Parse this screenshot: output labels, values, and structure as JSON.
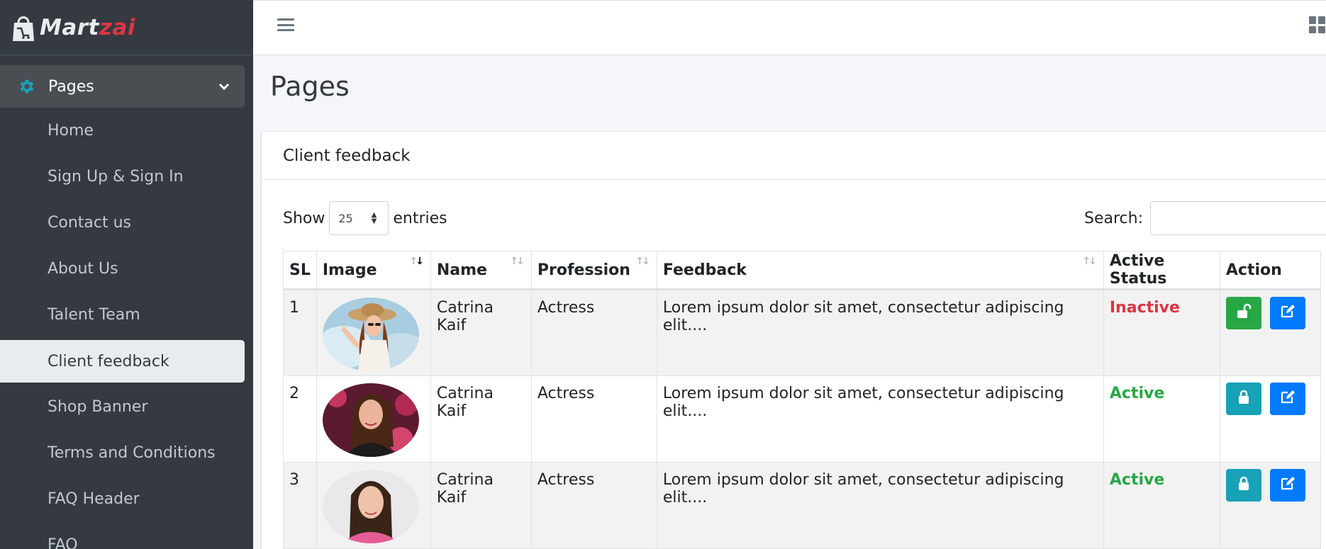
{
  "brand": {
    "name_part1": "Mart",
    "name_part2": "zai"
  },
  "sidebar": {
    "parent_label": "Pages",
    "items": [
      {
        "label": "Home",
        "active": false
      },
      {
        "label": "Sign Up & Sign In",
        "active": false
      },
      {
        "label": "Contact us",
        "active": false
      },
      {
        "label": "About Us",
        "active": false
      },
      {
        "label": "Talent Team",
        "active": false
      },
      {
        "label": "Client feedback",
        "active": true
      },
      {
        "label": "Shop Banner",
        "active": false
      },
      {
        "label": "Terms and Conditions",
        "active": false
      },
      {
        "label": "FAQ Header",
        "active": false
      },
      {
        "label": "FAQ",
        "active": false
      }
    ]
  },
  "page": {
    "title": "Pages"
  },
  "card": {
    "title": "Client feedback"
  },
  "table_controls": {
    "show_label": "Show",
    "entries_value": "25",
    "entries_label": "entries",
    "search_label": "Search:",
    "search_value": ""
  },
  "table": {
    "columns": [
      "SL",
      "Image",
      "Name",
      "Profession",
      "Feedback",
      "Active Status",
      "Action"
    ],
    "rows": [
      {
        "sl": "1",
        "name": "Catrina Kaif",
        "profession": "Actress",
        "feedback": "Lorem ipsum dolor sit amet, consectetur adipiscing elit....",
        "status": "Inactive"
      },
      {
        "sl": "2",
        "name": "Catrina Kaif",
        "profession": "Actress",
        "feedback": "Lorem ipsum dolor sit amet, consectetur adipiscing elit....",
        "status": "Active"
      },
      {
        "sl": "3",
        "name": "Catrina Kaif",
        "profession": "Actress",
        "feedback": "Lorem ipsum dolor sit amet, consectetur adipiscing elit....",
        "status": "Active"
      }
    ]
  },
  "colors": {
    "sidebar_bg": "#343a40",
    "accent_teal": "#17a2b8",
    "status_inactive": "#dc3545",
    "status_active": "#28a745",
    "btn_blue": "#007bff"
  },
  "icons": {
    "logo": "shopping-bag-logo-icon",
    "parent": "gear-icon",
    "collapse": "chevron-down-icon",
    "menu": "hamburger-icon",
    "apps": "grid-icon",
    "unlock": "unlock-icon",
    "lock": "lock-icon",
    "edit": "edit-icon"
  }
}
